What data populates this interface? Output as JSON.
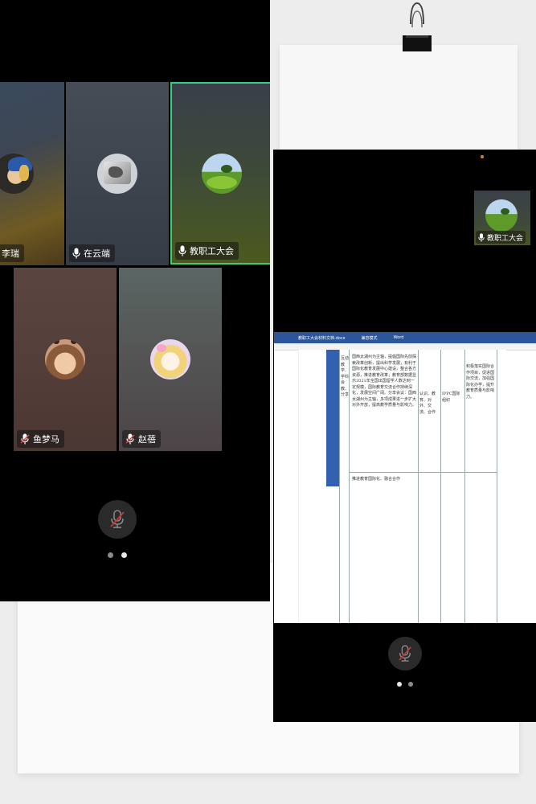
{
  "left_phone": {
    "participants": [
      {
        "name": "李瑞",
        "mic": "on",
        "avatar": "girl-with-pearl-earring-avatar"
      },
      {
        "name": "在云端",
        "mic": "on",
        "avatar": "animal-photo-avatar"
      },
      {
        "name": "教职工大会",
        "mic": "on",
        "avatar": "green-field-avatar",
        "active_speaker": true
      },
      {
        "name": "鱼梦马",
        "mic": "muted",
        "avatar": "child-photo-avatar"
      },
      {
        "name": "赵蓓",
        "mic": "muted",
        "avatar": "anime-girl-avatar"
      }
    ],
    "mic_button_state": "muted",
    "page_dots": {
      "count": 2,
      "active": 2
    }
  },
  "right_phone": {
    "floating_tile": {
      "name": "教职工大会",
      "mic": "on",
      "avatar": "green-field-avatar"
    },
    "document": {
      "title_parts": [
        "教职工大会材料文档.docx",
        "兼容模式",
        "Word"
      ],
      "col1_text": "互动教学、学科会教、分享",
      "col2_text": "国西太湖州为主轴，提倡国际先前探索改革创新，提出科学发展，有利于国际化教育发展中心建设，整合各方资源，推进教育改革；教育部数据显示2021年全国出国留学人数达到一定规模，国际教育交流合作持续深化，发展空间广阔。分享会议：国西太湖州为主轴，多项成果进一步扩大对外开放，提高教学质量与影响力。",
      "col2_text_b": "推进教育国际化、融合合作",
      "col3_text": "认识、教育、对外、交流、合作",
      "col4_text": "IPPC国际组织",
      "col5_text": "积极落实国际合作项目，促进国际交流，加强国际化办学，提升教育质量与影响力。"
    },
    "mic_button_state": "muted",
    "page_dots": {
      "count": 2,
      "active": 1
    }
  }
}
